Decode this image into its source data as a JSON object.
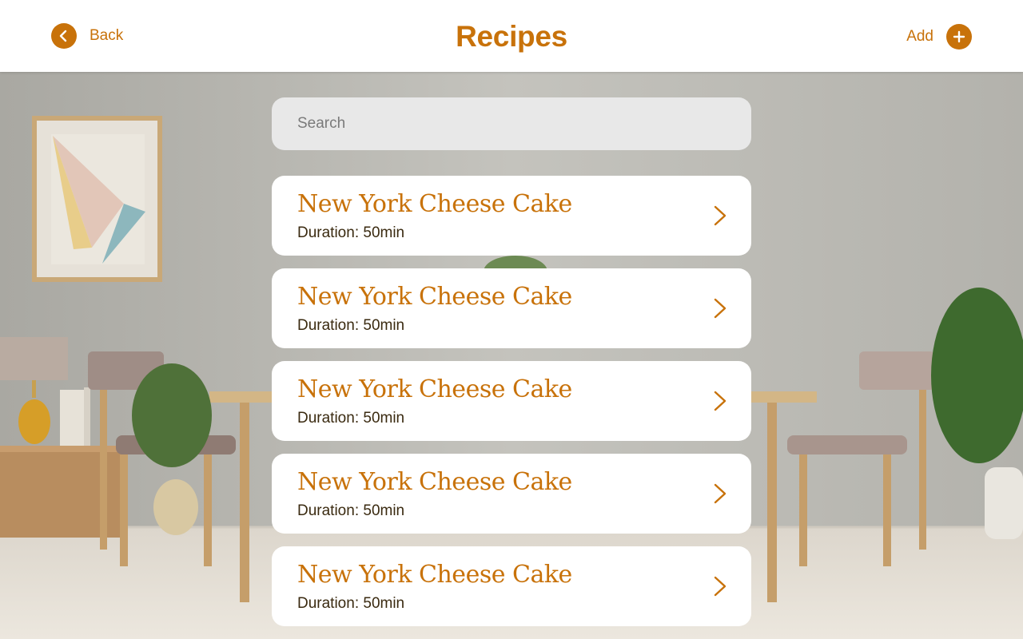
{
  "header": {
    "title": "Recipes",
    "back_label": "Back",
    "add_label": "Add"
  },
  "search": {
    "placeholder": "Search",
    "value": ""
  },
  "recipes": [
    {
      "name": "New York Cheese Cake",
      "duration": "Duration: 50min"
    },
    {
      "name": "New York Cheese Cake",
      "duration": "Duration: 50min"
    },
    {
      "name": "New York Cheese Cake",
      "duration": "Duration: 50min"
    },
    {
      "name": "New York Cheese Cake",
      "duration": "Duration: 50min"
    },
    {
      "name": "New York Cheese Cake",
      "duration": "Duration: 50min"
    }
  ],
  "icons": {
    "back": "chevron-left-icon",
    "add": "plus-icon",
    "row": "chevron-right-icon"
  },
  "colors": {
    "accent": "#c8720a",
    "header_bg": "#ffffff",
    "search_bg": "#e8e8e8",
    "card_bg": "#ffffff",
    "duration_text": "#3a2a10"
  }
}
